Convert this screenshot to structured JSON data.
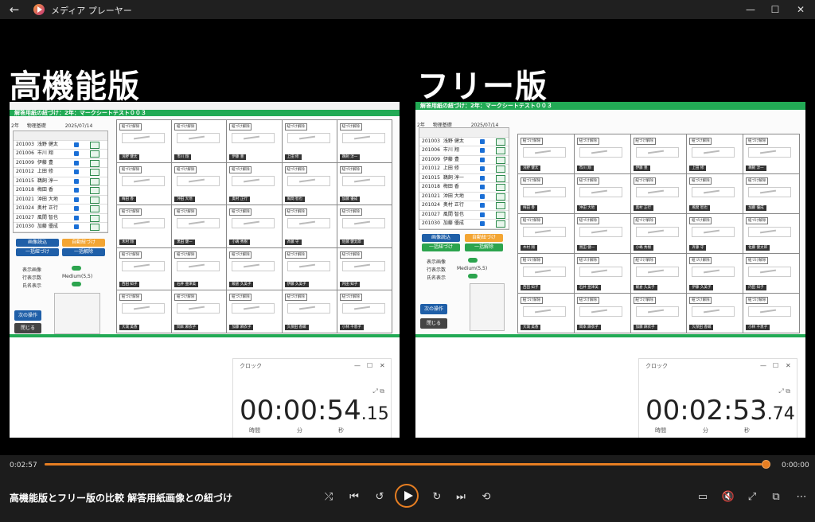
{
  "window": {
    "title": "メディア プレーヤー"
  },
  "video": {
    "left_label": "高機能版",
    "right_label": "フリー版",
    "left_app": {
      "title": "解答用紙の紐づけ：2年：マークシートテスト００３",
      "grade": "2年",
      "subject": "物理基礎",
      "date": "2025/07/14",
      "students": [
        {
          "id": "201003",
          "name": "浅野 健太"
        },
        {
          "id": "201006",
          "name": "市川 翔"
        },
        {
          "id": "201009",
          "name": "伊藤 豊"
        },
        {
          "id": "201012",
          "name": "上田 修"
        },
        {
          "id": "201015",
          "name": "鵜飼 淳一"
        },
        {
          "id": "201018",
          "name": "梅田 香"
        },
        {
          "id": "201021",
          "name": "沖田 大地"
        },
        {
          "id": "201024",
          "name": "奥村 正行"
        },
        {
          "id": "201027",
          "name": "風間 智也"
        },
        {
          "id": "201030",
          "name": "加藤 優成"
        }
      ],
      "buttons": {
        "image_load": "画像読込",
        "auto_link": "自動紐づけ",
        "bulk_link": "一括紐づけ",
        "bulk_unlink": "一括解除",
        "next": "次の操作",
        "close": "閉じる"
      },
      "options": {
        "display_image": "表示画像",
        "rows": "行表示数",
        "rows_value": "Medium(5,5)",
        "name_display": "氏名表示"
      },
      "row_names": [
        [
          "浅野 健太",
          "市川 翔",
          "伊藤 豊",
          "上田 修",
          "鵜飼 淳一"
        ],
        [
          "梅田 香",
          "沖田 大地",
          "奥村 正行",
          "風間 智也",
          "加藤 優成"
        ],
        [
          "木村 翔",
          "黒田 健一",
          "小嶋 秀樹",
          "斉藤 守",
          "佐藤 健太郎"
        ],
        [
          "西田 知子",
          "石井 亜津美",
          "飯倉 久美子",
          "伊藤 久美子",
          "内田 知子"
        ],
        [
          "大城 美香",
          "岡本 麻衣子",
          "加藤 麻衣子",
          "久保田 香織",
          "小林 千恵子"
        ]
      ],
      "tag": "紐づけ解除"
    },
    "left_clock": {
      "app": "クロック",
      "time_main": "00:00:54",
      "time_frac": ".15",
      "labels": [
        "時間",
        "分",
        "秒"
      ]
    },
    "right_clock": {
      "app": "クロック",
      "time_main": "00:02:53",
      "time_frac": ".74",
      "labels": [
        "時間",
        "分",
        "秒"
      ]
    }
  },
  "player": {
    "elapsed": "0:02:57",
    "remaining": "0:00:00",
    "progress": 0.995,
    "title": "高機能版とフリー版の比較 解答用紙画像との紐づけ",
    "accent": "#e67e22"
  }
}
